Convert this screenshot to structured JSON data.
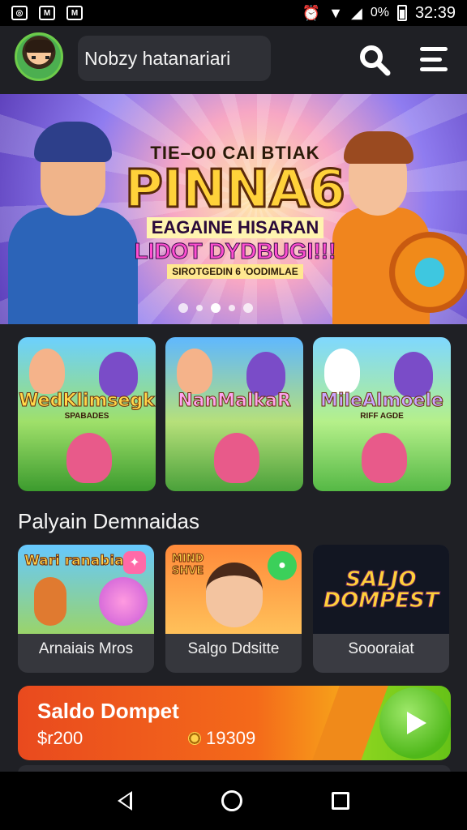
{
  "statusbar": {
    "time": "32:39",
    "signal_text": "0%",
    "icons": [
      "instagram-icon",
      "notification-m-icon",
      "notification-m-icon",
      "alarm-icon",
      "wifi-icon",
      "signal-icon",
      "battery-icon"
    ]
  },
  "header": {
    "search_text": "Nobzy hatanariari",
    "search_icon": "search-icon",
    "menu_icon": "menu-icon"
  },
  "hero": {
    "kicker": "TIE–O0 CAI BTIAK",
    "title": "PINNA6",
    "subtitle1": "EAGAINE HISARAN",
    "subtitle2": "LIDOT DYDBUGI!!!",
    "subtitle3": "SIROTGEDIN 6 'OODIMLAE",
    "dots": 5,
    "active_dot": 3
  },
  "games": [
    {
      "title": "WedKlimsegk",
      "subtitle": "SPABADES"
    },
    {
      "title": "NanMalkaR",
      "subtitle": ""
    },
    {
      "title": "MileAlmoele",
      "subtitle": "RIFF AGDE"
    }
  ],
  "section": {
    "title": "Palyain Demnaidas"
  },
  "tiles": [
    {
      "thumb_title": "Wari ranabiai",
      "label": "Arnaiais Mros",
      "badge_icon": "gamepad-icon"
    },
    {
      "thumb_title": "MIND SHVE",
      "label": "Salgo Ddsitte",
      "badge_icon": "controller-icon"
    },
    {
      "thumb_title": "SALJO DOMPEST",
      "label": "Soooraiat",
      "badge_icon": ""
    }
  ],
  "wallet": {
    "title": "Saldo Dompet",
    "amount": "$r200",
    "coins": "19309",
    "play_icon": "play-icon"
  },
  "colors": {
    "background": "#1f2025",
    "wallet_orange": "#f46a1a",
    "play_green": "#4fb81a"
  }
}
